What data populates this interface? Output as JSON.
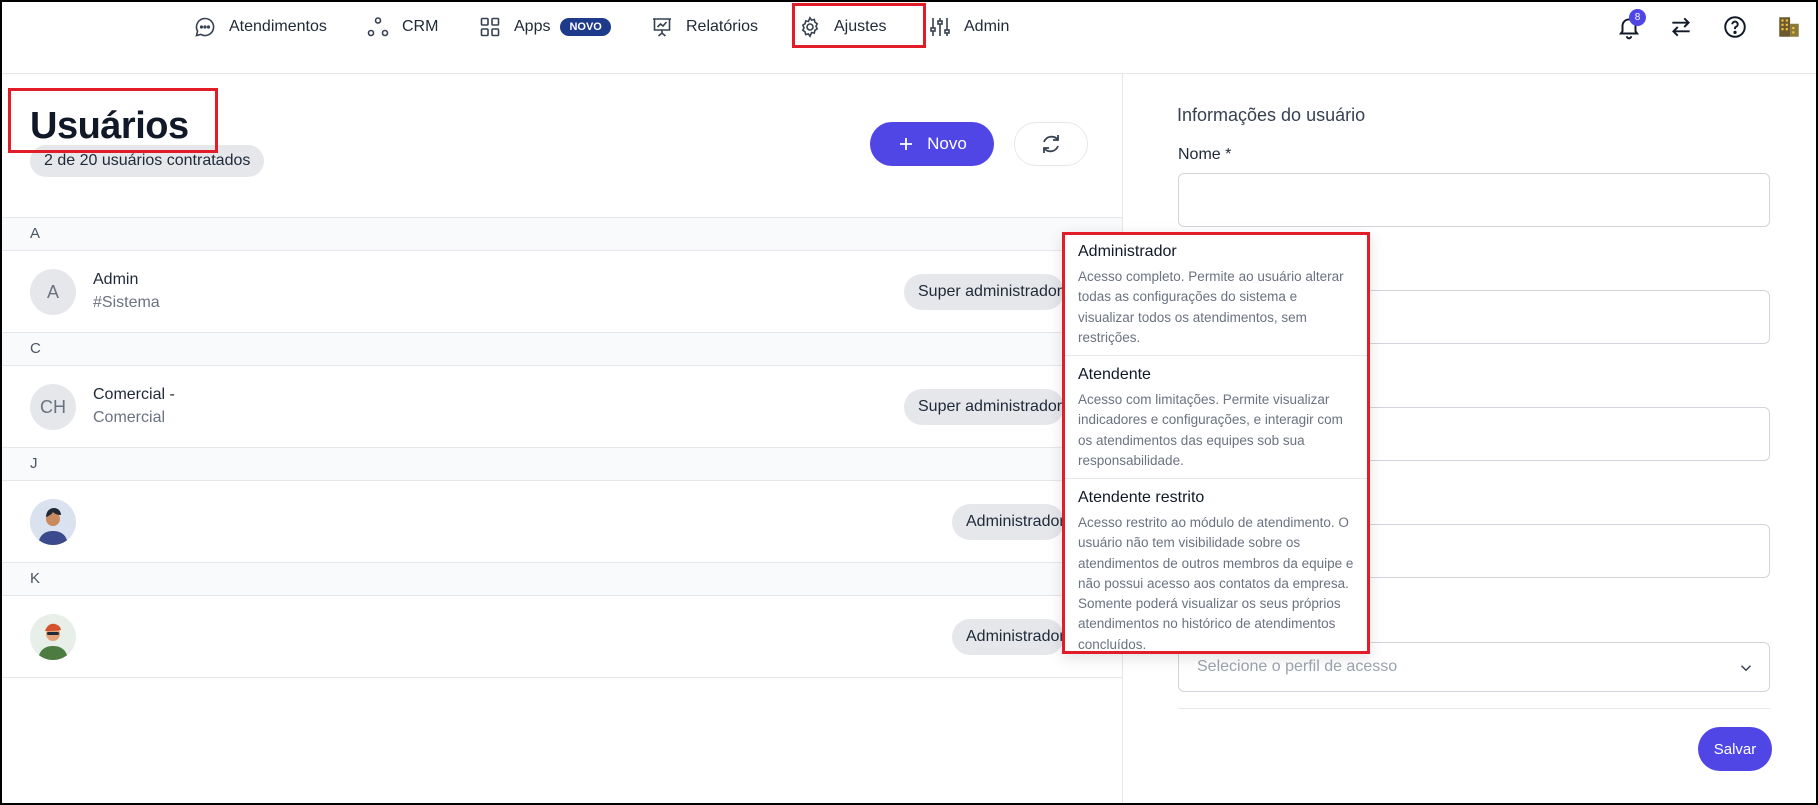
{
  "nav": {
    "items": [
      {
        "label": "Atendimentos",
        "icon": "chat-bubble-icon"
      },
      {
        "label": "CRM",
        "icon": "nodes-icon"
      },
      {
        "label": "Apps",
        "icon": "grid-icon",
        "badge": "NOVO"
      },
      {
        "label": "Relatórios",
        "icon": "presentation-chart-icon"
      },
      {
        "label": "Ajustes",
        "icon": "gear-icon"
      },
      {
        "label": "Admin",
        "icon": "sliders-icon"
      }
    ],
    "notification_count": "8",
    "right_icons": [
      "bell-icon",
      "swap-arrows-icon",
      "help-icon",
      "building-icon"
    ]
  },
  "page": {
    "title": "Usuários",
    "subtitle": "2 de 20 usuários contratados",
    "new_button": "Novo"
  },
  "users": {
    "groups": [
      {
        "letter": "A",
        "rows": [
          {
            "initials": "A",
            "name": "Admin",
            "sub": "#Sistema",
            "role": "Super administrador"
          }
        ]
      },
      {
        "letter": "C",
        "rows": [
          {
            "initials": "CH",
            "name": "Comercial -",
            "sub": "Comercial",
            "role": "Super administrador"
          }
        ]
      },
      {
        "letter": "J",
        "rows": [
          {
            "initials": "",
            "name": "",
            "sub": "",
            "role": "Administrador"
          }
        ]
      },
      {
        "letter": "K",
        "rows": [
          {
            "initials": "",
            "name": "",
            "sub": "",
            "role": "Administrador"
          }
        ]
      }
    ]
  },
  "form": {
    "title": "Informações do usuário",
    "name_label": "Nome *",
    "profile_placeholder": "Selecione o perfil de acesso",
    "save_button": "Salvar"
  },
  "dropdown": {
    "options": [
      {
        "title": "Administrador",
        "desc": "Acesso completo. Permite ao usuário alterar todas as configurações do sistema e visualizar todos os atendimentos, sem restrições."
      },
      {
        "title": "Atendente",
        "desc": "Acesso com limitações. Permite visualizar indicadores e configurações, e interagir com os atendimentos das equipes sob sua responsabilidade."
      },
      {
        "title": "Atendente restrito",
        "desc": "Acesso restrito ao módulo de atendimento. O usuário não tem visibilidade sobre os atendimentos de outros membros da equipe e não possui acesso aos contatos da empresa. Somente poderá visualizar os seus próprios atendimentos no histórico de atendimentos concluídos."
      }
    ]
  },
  "colors": {
    "accent": "#4f46e5",
    "highlight": "#e11d2a",
    "badge": "#1e3a8a"
  }
}
